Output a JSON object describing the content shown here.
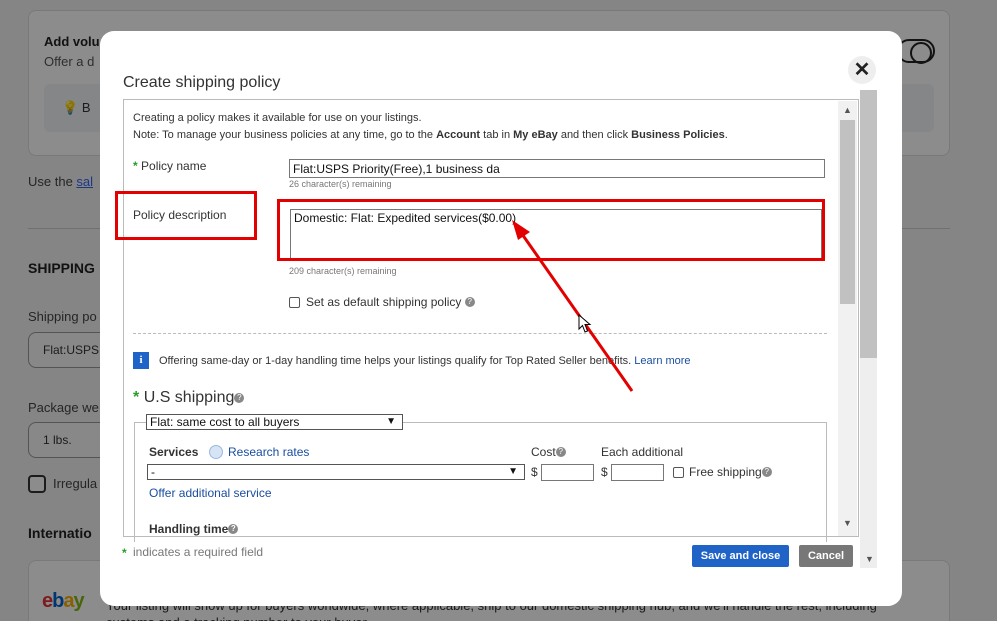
{
  "background": {
    "card_title": "Add volu",
    "card_subtitle": "Offer a d",
    "bulb_text": "B",
    "use_text": "Use the ",
    "use_link": "sal",
    "shipping_heading": "SHIPPING",
    "shipping_policy_label": "Shipping po",
    "shipping_policy_value": "Flat:USPS",
    "package_label": "Package we",
    "package_value": "1    lbs.",
    "irregular_label": "Irregula",
    "international_heading": "Internatio",
    "ebay_text": "Your listing will show up for buyers worldwide, where applicable, ship to our domestic shipping hub, and we'll handle the rest, including customs and a tracking number to your buyer."
  },
  "modal": {
    "title": "Create shipping policy",
    "close_glyph": "✕",
    "intro_line1": "Creating a policy makes it available for use on your listings.",
    "intro_line2_a": "Note: To manage your business policies at any time, go to the ",
    "intro_line2_b": "Account",
    "intro_line2_c": " tab in ",
    "intro_line2_d": "My eBay",
    "intro_line2_e": " and then click ",
    "intro_line2_f": "Business Policies",
    "intro_line2_g": ".",
    "required_star": "*",
    "policy_name_label": "Policy name",
    "policy_name_value": "Flat:USPS Priority(Free),1 business da",
    "policy_name_remaining": "26 character(s) remaining",
    "policy_desc_label": "Policy description",
    "policy_desc_value": "Domestic: Flat: Expedited services($0.00)",
    "policy_desc_remaining": "209 character(s) remaining",
    "default_label": "Set as default shipping policy",
    "help_glyph": "?",
    "info_glyph": "i",
    "info_text": "Offering same-day or 1-day handling time helps your listings qualify for Top Rated Seller benefits. ",
    "info_link": "Learn more",
    "us_shipping_heading": "U.S shipping",
    "flat_select_value": "Flat: same cost to all buyers",
    "services_label": "Services",
    "research_rates": "Research rates",
    "cost_label": "Cost",
    "each_additional_label": "Each additional",
    "services_select_value": "-",
    "currency": "$",
    "free_shipping_label": "Free shipping",
    "offer_additional": "Offer additional service",
    "handling_time_label": "Handling time",
    "footer_note": "indicates a required field",
    "save_button": "Save and close",
    "cancel_button": "Cancel"
  },
  "colors": {
    "annotation_red": "#e30000",
    "save_blue": "#1f63c6",
    "required_green": "#2a9d2a",
    "link_blue": "#1a4ea0"
  }
}
